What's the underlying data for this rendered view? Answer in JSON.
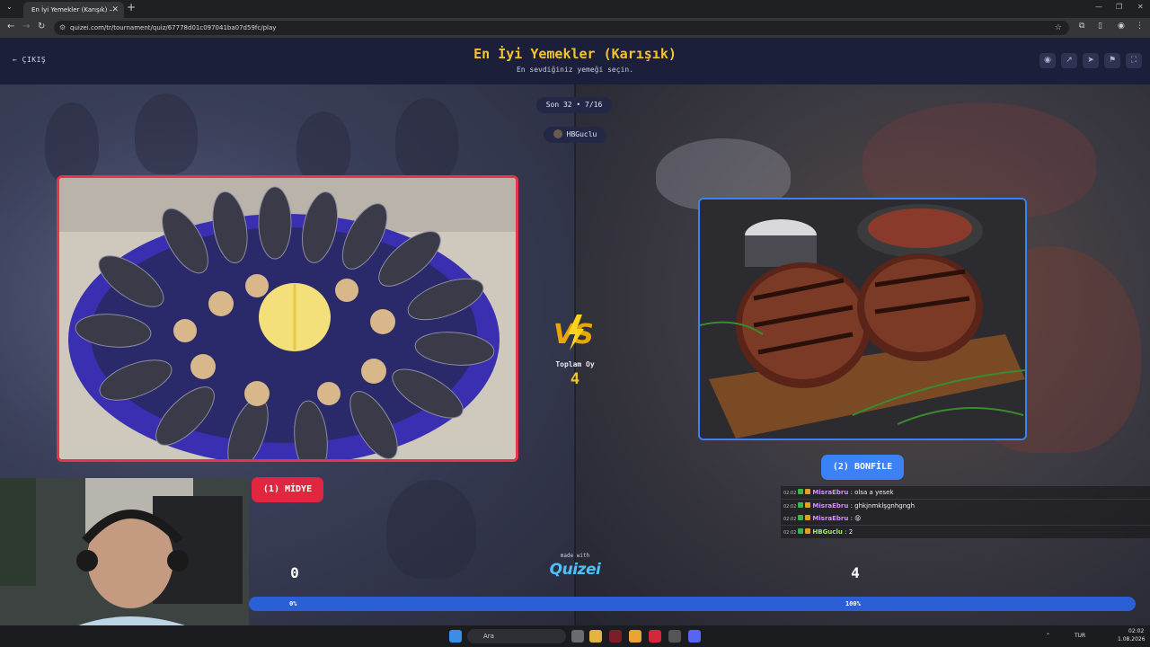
{
  "browser": {
    "tab_title": "En İyi Yemekler (Karışık) – Tier L",
    "url": "quizei.com/tr/tournament/quiz/67778d01c097041ba07d59fc/play"
  },
  "header": {
    "exit_label": "ÇIKIŞ",
    "title": "En İyi Yemekler (Karışık)",
    "subtitle": "En sevdiğiniz yemeği seçin."
  },
  "round": {
    "label": "Son 32 • 7/16"
  },
  "player": {
    "name": "HBGuclu"
  },
  "total_votes": {
    "label": "Toplam Oy",
    "value": "4"
  },
  "choices": {
    "left": {
      "label": "(1) MİDYE",
      "score": "0",
      "percent": "0%"
    },
    "right": {
      "label": "(2) BONFİLE",
      "score": "4",
      "percent": "100%"
    }
  },
  "vote_share": {
    "left": 0,
    "right": 1
  },
  "made_with": "made with",
  "logo": "Quizei",
  "chat": [
    {
      "time": "02:02",
      "user": "MisraEbru",
      "message": "olsa a yesek",
      "color": "#d291ff"
    },
    {
      "time": "02:02",
      "user": "MisraEbru",
      "message": "ghkjnmklşgnhgngh",
      "color": "#d291ff"
    },
    {
      "time": "02:02",
      "user": "MisraEbru",
      "message": "😝",
      "color": "#d291ff"
    },
    {
      "time": "02:02",
      "user": "HBGuclu",
      "message": "2",
      "color": "#9ef05e"
    }
  ],
  "taskbar": {
    "search_placeholder": "Ara",
    "lang": "TUR",
    "time": "02:02",
    "date": "1.08.2026"
  },
  "colors": {
    "accent_red": "#e0273f",
    "accent_blue": "#3b82f6",
    "title_gold": "#f5c42c"
  }
}
